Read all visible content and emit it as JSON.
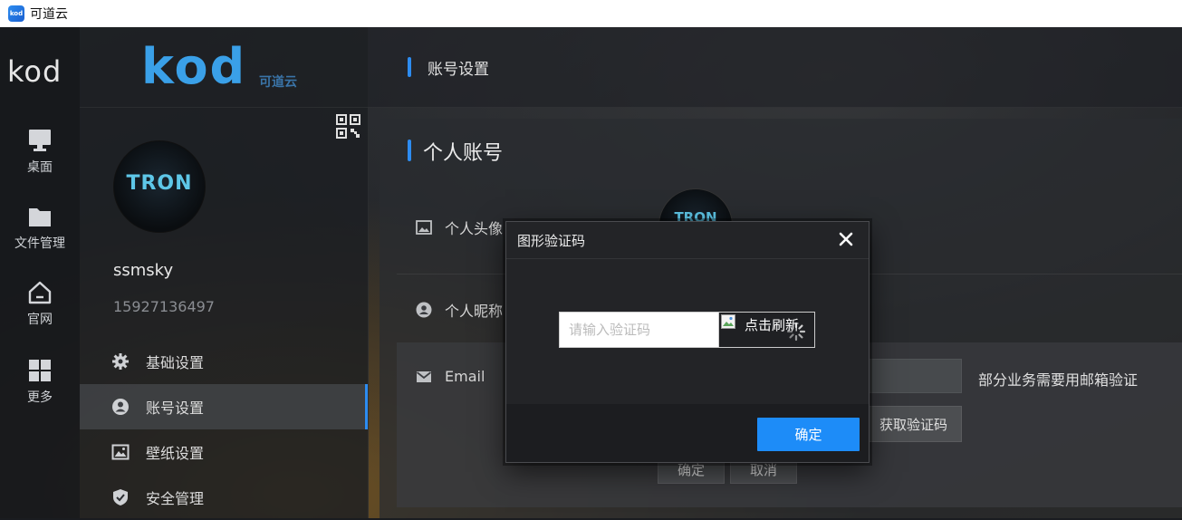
{
  "window": {
    "title": "可道云",
    "app_icon": "kod"
  },
  "rail": {
    "logo": "kod",
    "items": [
      {
        "label": "桌面",
        "icon": "monitor-icon"
      },
      {
        "label": "文件管理",
        "icon": "folder-icon"
      },
      {
        "label": "官网",
        "icon": "home-icon"
      },
      {
        "label": "更多",
        "icon": "grid-icon"
      }
    ]
  },
  "brand": {
    "logo": "kod",
    "subtitle": "可道云"
  },
  "profile": {
    "avatar_text": "TRON",
    "username": "ssmsky",
    "phone": "15927136497"
  },
  "nav": {
    "items": [
      {
        "label": "基础设置",
        "icon": "gear-icon",
        "active": false
      },
      {
        "label": "账号设置",
        "icon": "user-icon",
        "active": true
      },
      {
        "label": "壁纸设置",
        "icon": "image-icon",
        "active": false
      },
      {
        "label": "安全管理",
        "icon": "shield-icon",
        "active": false
      }
    ]
  },
  "header": {
    "title": "账号设置"
  },
  "panel": {
    "title": "个人账号",
    "rows": {
      "avatar_label": "个人头像",
      "nickname_label": "个人昵称",
      "email_label": "Email"
    },
    "email_hint": "部分业务需要用邮箱验证",
    "get_code_button": "获取验证码",
    "confirm_button": "确定",
    "cancel_button": "取消"
  },
  "modal": {
    "title": "图形验证码",
    "captcha_placeholder": "请输入验证码",
    "captcha_refresh_text": "点击刷新",
    "confirm_button": "确定"
  },
  "colors": {
    "accent": "#2d8cf0",
    "primary_button": "#1d8cf8"
  }
}
